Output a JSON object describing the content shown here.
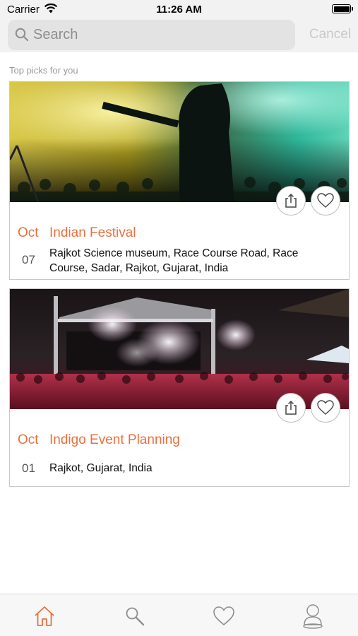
{
  "status_bar": {
    "carrier": "Carrier",
    "time": "11:26 AM"
  },
  "search": {
    "placeholder": "Search",
    "cancel_label": "Cancel"
  },
  "section_label": "Top picks for you",
  "events": [
    {
      "month": "Oct",
      "day": "07",
      "title": "Indian Festival",
      "address": "Rajkot Science museum, Race Course Road, Race Course, Sadar, Rajkot, Gujarat, India"
    },
    {
      "month": "Oct",
      "day": "01",
      "title": "Indigo Event Planning",
      "address": "Rajkot, Gujarat, India"
    }
  ],
  "tabs": [
    {
      "name": "home",
      "icon": "home-icon",
      "active": true
    },
    {
      "name": "search",
      "icon": "search-icon",
      "active": false
    },
    {
      "name": "favorites",
      "icon": "heart-icon",
      "active": false
    },
    {
      "name": "profile",
      "icon": "user-icon",
      "active": false
    }
  ],
  "colors": {
    "accent": "#e8703d",
    "inactive_tab": "#8e8e8e",
    "cancel": "#c9c9c9"
  }
}
